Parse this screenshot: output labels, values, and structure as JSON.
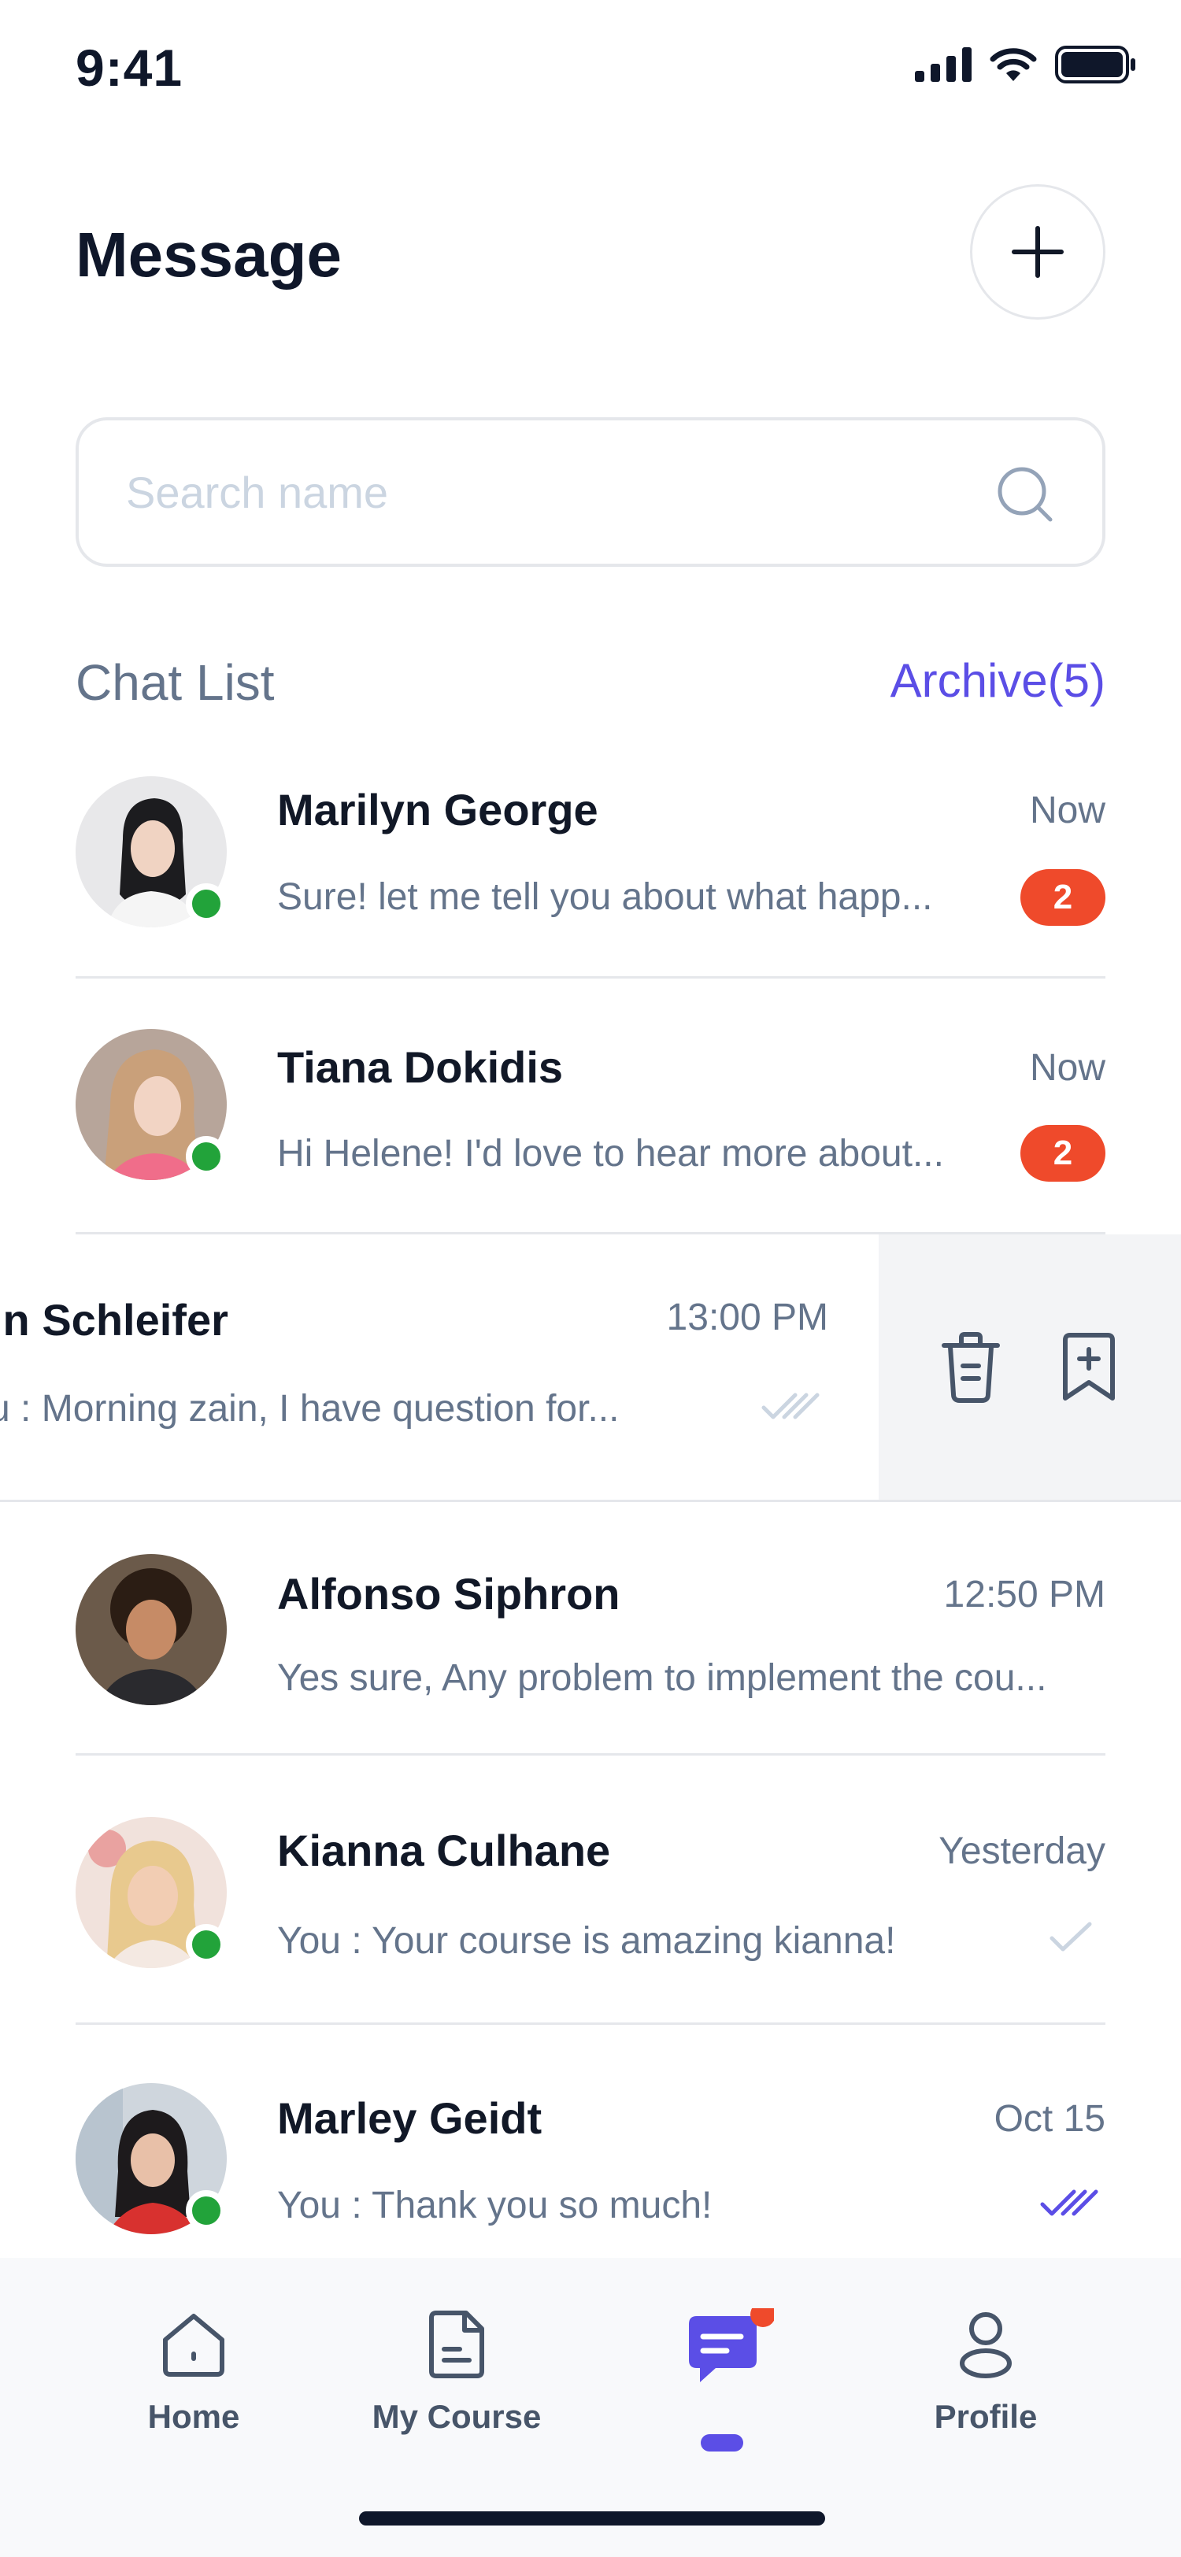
{
  "status_bar": {
    "time": "9:41"
  },
  "header": {
    "title": "Message"
  },
  "search": {
    "placeholder": "Search name"
  },
  "chat_list": {
    "title": "Chat List",
    "archive_label": "Archive(5)"
  },
  "chats": [
    {
      "name": "Marilyn George",
      "time": "Now",
      "preview": "Sure! let me tell you about what happ...",
      "unread": "2",
      "online": true
    },
    {
      "name": "Tiana Dokidis",
      "time": "Now",
      "preview": "Hi Helene! I'd love to hear more about...",
      "unread": "2",
      "online": true
    },
    {
      "name": "in Schleifer",
      "time": "13:00 PM",
      "preview": "u : Morning zain, I have question for...",
      "read_status": "double-check",
      "swiped": true
    },
    {
      "name": "Alfonso Siphron",
      "time": "12:50 PM",
      "preview": "Yes sure, Any problem to implement the cou...",
      "online": false
    },
    {
      "name": "Kianna Culhane",
      "time": "Yesterday",
      "preview": "You : Your course is amazing kianna!",
      "read_status": "single-check",
      "online": true
    },
    {
      "name": "Marley Geidt",
      "time": "Oct 15",
      "preview": "You : Thank you so much!",
      "read_status": "double-check-read",
      "online": true
    }
  ],
  "bottom_nav": {
    "items": [
      {
        "label": "Home",
        "icon": "home-icon"
      },
      {
        "label": "My Course",
        "icon": "course-icon"
      },
      {
        "label": "",
        "icon": "message-icon",
        "active": true,
        "notification_dot": true
      },
      {
        "label": "Profile",
        "icon": "profile-icon"
      }
    ]
  },
  "colors": {
    "accent": "#5b4ee6",
    "badge": "#ef4a2b",
    "online": "#22a33a",
    "muted": "#64748b"
  }
}
